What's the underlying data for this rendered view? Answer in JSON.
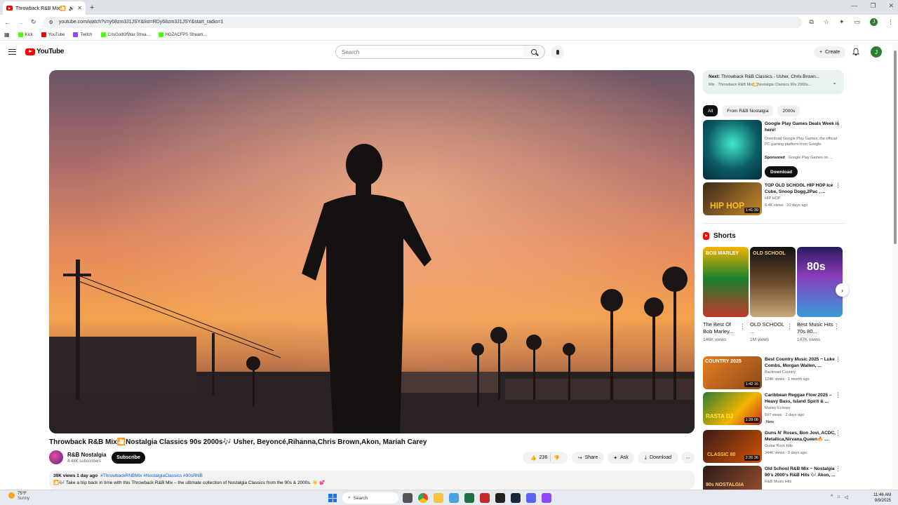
{
  "browser": {
    "tab_title": "Throwback R&B Mix🎦Nos",
    "url": "youtube.com/watch?v=y68zm3J1JSY&list=RDy68zm3J1JSY&start_radio=1",
    "bookmarks": [
      {
        "label": "Kick",
        "color": "#53fc18"
      },
      {
        "label": "YouTube",
        "color": "#ff0000"
      },
      {
        "label": "Twitch",
        "color": "#9146ff"
      },
      {
        "label": "CrisGodOfWar Strea...",
        "color": "#53fc18"
      },
      {
        "label": "HGZACFPS Stream...",
        "color": "#53fc18"
      }
    ]
  },
  "header": {
    "logo_text": "YouTube",
    "search_placeholder": "Search",
    "create_label": "Create",
    "avatar_letter": "J"
  },
  "video": {
    "title": "Throwback R&B Mix🎦Nostalgia Classics 90s 2000s🎶 Usher, Beyoncé,Rihanna,Chris Brown,Akon, Mariah Carey",
    "channel": "R&B Nostalgia",
    "subscribers": "4.48K subscribers",
    "subscribe_label": "Subscribe",
    "likes": "236",
    "share_label": "Share",
    "ask_label": "Ask",
    "download_label": "Download",
    "views_date": "39K views  1 day ago",
    "hashtags": "#ThrowbackRNBMix #NostalgiaClassics #90sRNB",
    "description": "🎦🎶 Take a trip back in time with this Throwback R&B Mix – the ultimate collection of Nostalgia Classics from the 90s & 2000s. ☀️ 💕"
  },
  "sidebar": {
    "next_label": "Next:",
    "next_title": "Throwback R&B Classics - Usher, Chris Brown...",
    "next_sub": "Mix · Throwback R&B Mix🎦Nostalgia Classics 90s 2000s...",
    "chips": [
      "All",
      "From R&B Nostalgia",
      "2000s"
    ],
    "ad": {
      "title": "Google Play Games Deals Week is here!",
      "body": "Download Google Play Games, the official PC gaming platform from Google.",
      "sponsored": "Sponsored",
      "advertiser": " · Google Play Games on ...",
      "cta": "Download"
    },
    "rec_top": {
      "title": "TOP OLD SCHOOL HIP HOP Ice Cube, Snoop Dogg,2Pac , ...",
      "channel": "HIP HOP",
      "views": "6.4K views · 10 days ago",
      "duration": "1:41:39",
      "thumb_text": "HIP HOP"
    },
    "shorts_label": "Shorts",
    "shorts": [
      {
        "title": "The Best Of Bob Marley...",
        "views": "146K views",
        "thumb_text": "BOB MARLEY"
      },
      {
        "title": "OLD SCHOOL ...",
        "views": "1M views",
        "thumb_text": "OLD SCHOOL"
      },
      {
        "title": "Best Music Hits 70s 80...",
        "views": "147K views",
        "thumb_text": "80s"
      }
    ],
    "recs": [
      {
        "title": "Best Country Music 2025 ~ Luke Combs, Morgan Wallen, ...",
        "channel": "Backroad Country",
        "views": "124K views · 1 month ago",
        "duration": "1:42:16",
        "badge": "",
        "thumb_text": "COUNTRY 2025"
      },
      {
        "title": "Caribbean Reggae Flow 2025 – Heavy Bass, Island Spirit & ...",
        "channel": "Marley Echoes",
        "views": "597 views · 2 days ago",
        "duration": "1:28:08",
        "badge": "New",
        "thumb_text": "RASTA DJ"
      },
      {
        "title": "Guns N' Roses, Bon Jovi, ACDC, Metallica,Nirvana,Queen🔥 ...",
        "channel": "Guitar Rock Hits",
        "views": "344K views · 9 days ago",
        "duration": "2:26:36",
        "badge": "",
        "thumb_text": "CLASSIC 80"
      },
      {
        "title": "Old School R&B Mix ~ Nostalgia 90's 2000's R&B Hits 🎶 Akon, ...",
        "channel": "R&B Music Hits",
        "views": "",
        "duration": "",
        "badge": "",
        "thumb_text": "90s NOSTALGIA"
      }
    ]
  },
  "taskbar": {
    "temperature": "75°F",
    "condition": "Sunny",
    "search_label": "Search",
    "time": "11:46 AM",
    "date": "9/9/2025"
  }
}
